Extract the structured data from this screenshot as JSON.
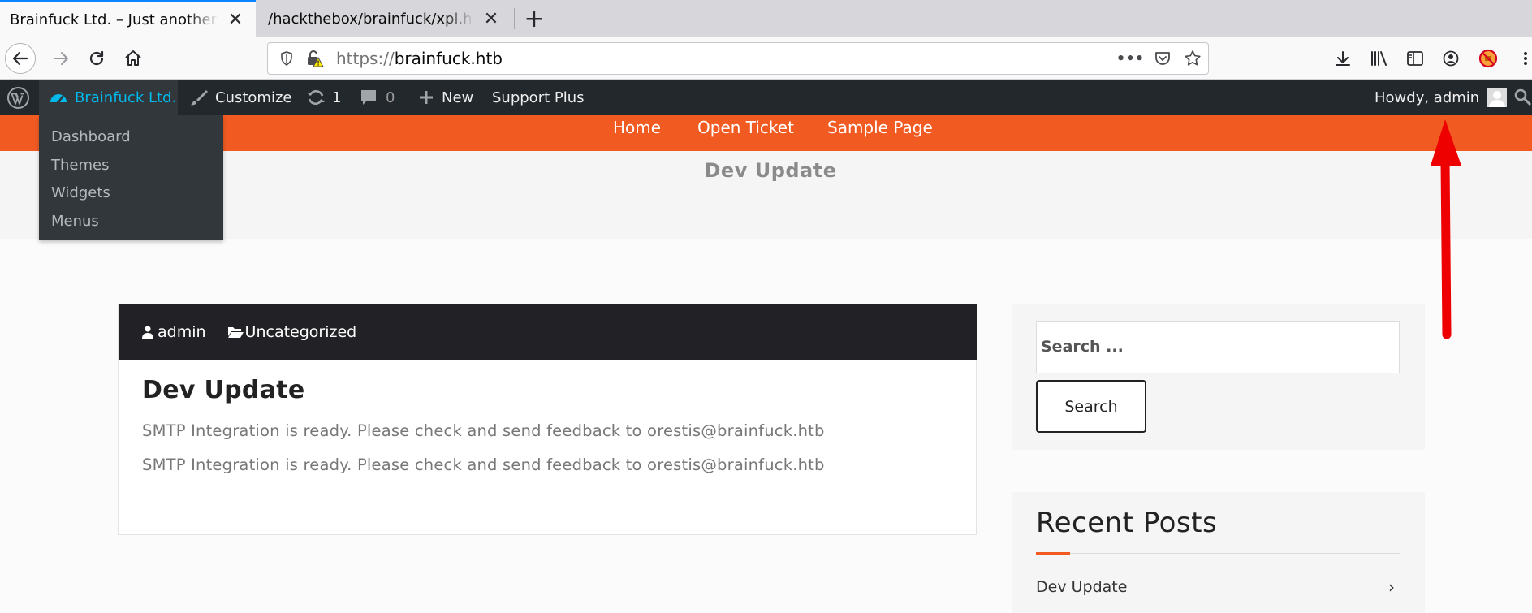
{
  "browser": {
    "tabs": [
      {
        "title": "Brainfuck Ltd. – Just another",
        "close": "✕"
      },
      {
        "title": "/hackthebox/brainfuck/xpl.ht",
        "close": "✕"
      }
    ],
    "new_tab": "+",
    "url_protocol": "https://",
    "url_host": "brainfuck.htb",
    "url_more": "•••"
  },
  "adminbar": {
    "site_name": "Brainfuck Ltd.",
    "customize": "Customize",
    "updates_count": "1",
    "comments_count": "0",
    "new_label": "New",
    "support_plus": "Support Plus",
    "howdy": "Howdy, admin",
    "dropdown": [
      "Dashboard",
      "Themes",
      "Widgets",
      "Menus"
    ]
  },
  "site": {
    "menu": [
      "Home",
      "Open Ticket",
      "Sample Page"
    ],
    "page_title": "Dev Update"
  },
  "post": {
    "author": "admin",
    "category": "Uncategorized",
    "title": "Dev Update",
    "lines": [
      "SMTP Integration is ready. Please check and send feedback to orestis@brainfuck.htb",
      "SMTP Integration is ready. Please check and send feedback to orestis@brainfuck.htb"
    ]
  },
  "sidebar": {
    "search_placeholder": "Search ...",
    "search_button": "Search",
    "recent_title": "Recent Posts",
    "recent_items": [
      {
        "label": "Dev Update",
        "chevron": "›"
      }
    ]
  },
  "colors": {
    "accent": "#f15b22",
    "adminbar": "#23282d",
    "annotation": "#ee0000"
  }
}
